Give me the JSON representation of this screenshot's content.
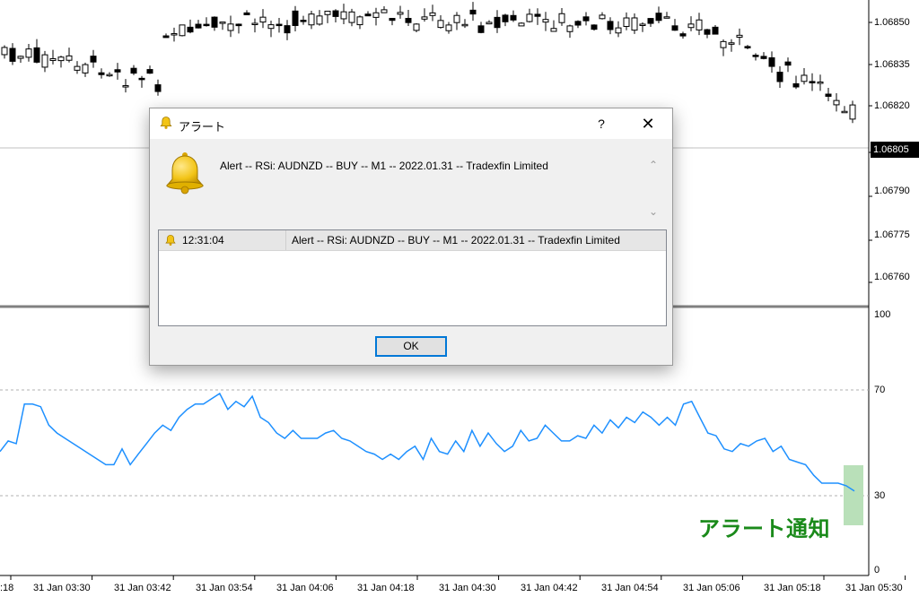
{
  "price_axis": {
    "labels": [
      "1.06850",
      "1.06835",
      "1.06820",
      "1.06805",
      "1.06790",
      "1.06775",
      "1.06760"
    ],
    "current_price": "1.06805"
  },
  "rsi_axis": {
    "labels": [
      "100",
      "70",
      "30",
      "0"
    ]
  },
  "time_axis": {
    "labels": [
      ":18",
      "31 Jan 03:30",
      "31 Jan 03:42",
      "31 Jan 03:54",
      "31 Jan 04:06",
      "31 Jan 04:18",
      "31 Jan 04:30",
      "31 Jan 04:42",
      "31 Jan 04:54",
      "31 Jan 05:06",
      "31 Jan 05:18",
      "31 Jan 05:30"
    ]
  },
  "dialog": {
    "title": "アラート",
    "help": "?",
    "close": "✕",
    "message": "Alert -- RSi: AUDNZD  --  BUY  --  M1  --  2022.01.31 -- Tradexfin Limited",
    "alerts": [
      {
        "time": "12:31:04",
        "message": "Alert -- RSi: AUDNZD  --  BUY  --  M1  --  2022.01.31 -- Tradexfin Limited"
      }
    ],
    "ok_label": "OK"
  },
  "annotation": "アラート通知",
  "colors": {
    "rsi_line": "#1e90ff",
    "highlight": "#b9e0b9",
    "annotation": "#1a8a1a"
  },
  "chart_data": [
    {
      "type": "line",
      "title": "",
      "ylim": [
        0,
        100
      ],
      "levels": [
        30,
        70
      ],
      "x": [
        0,
        1,
        2,
        3,
        4,
        5,
        6,
        7,
        8,
        9,
        10,
        11,
        12,
        13,
        14,
        15,
        16,
        17,
        18,
        19,
        20,
        21,
        22,
        23,
        24,
        25,
        26,
        27,
        28,
        29,
        30,
        31,
        32,
        33,
        34,
        35,
        36,
        37,
        38,
        39,
        40,
        41,
        42,
        43,
        44,
        45,
        46,
        47,
        48,
        49,
        50,
        51,
        52,
        53,
        54,
        55,
        56,
        57,
        58,
        59,
        60,
        61,
        62,
        63,
        64,
        65,
        66,
        67,
        68,
        69,
        70,
        71,
        72,
        73,
        74,
        75,
        76,
        77,
        78,
        79,
        80,
        81,
        82,
        83,
        84,
        85,
        86,
        87,
        88,
        89,
        90,
        91,
        92,
        93,
        94,
        95,
        96,
        97,
        98,
        99,
        100,
        101,
        102,
        103,
        104,
        105
      ],
      "series": [
        {
          "values": [
            45,
            49,
            48,
            63,
            63,
            62,
            55,
            52,
            50,
            48,
            46,
            44,
            42,
            40,
            40,
            46,
            40,
            44,
            48,
            52,
            55,
            53,
            58,
            61,
            63,
            63,
            65,
            67,
            61,
            64,
            62,
            66,
            58,
            56,
            52,
            50,
            53,
            50,
            50,
            50,
            52,
            53,
            50,
            49,
            47,
            45,
            44,
            42,
            44,
            42,
            45,
            47,
            42,
            50,
            45,
            44,
            49,
            45,
            53,
            47,
            52,
            48,
            45,
            47,
            53,
            49,
            50,
            55,
            52,
            49,
            49,
            51,
            50,
            55,
            52,
            57,
            54,
            58,
            56,
            60,
            58,
            55,
            58,
            55,
            63,
            64,
            58,
            52,
            51,
            46,
            45,
            48,
            47,
            49,
            50,
            45,
            47,
            42,
            41,
            40,
            36,
            33,
            33,
            33,
            32,
            30
          ]
        }
      ]
    }
  ]
}
